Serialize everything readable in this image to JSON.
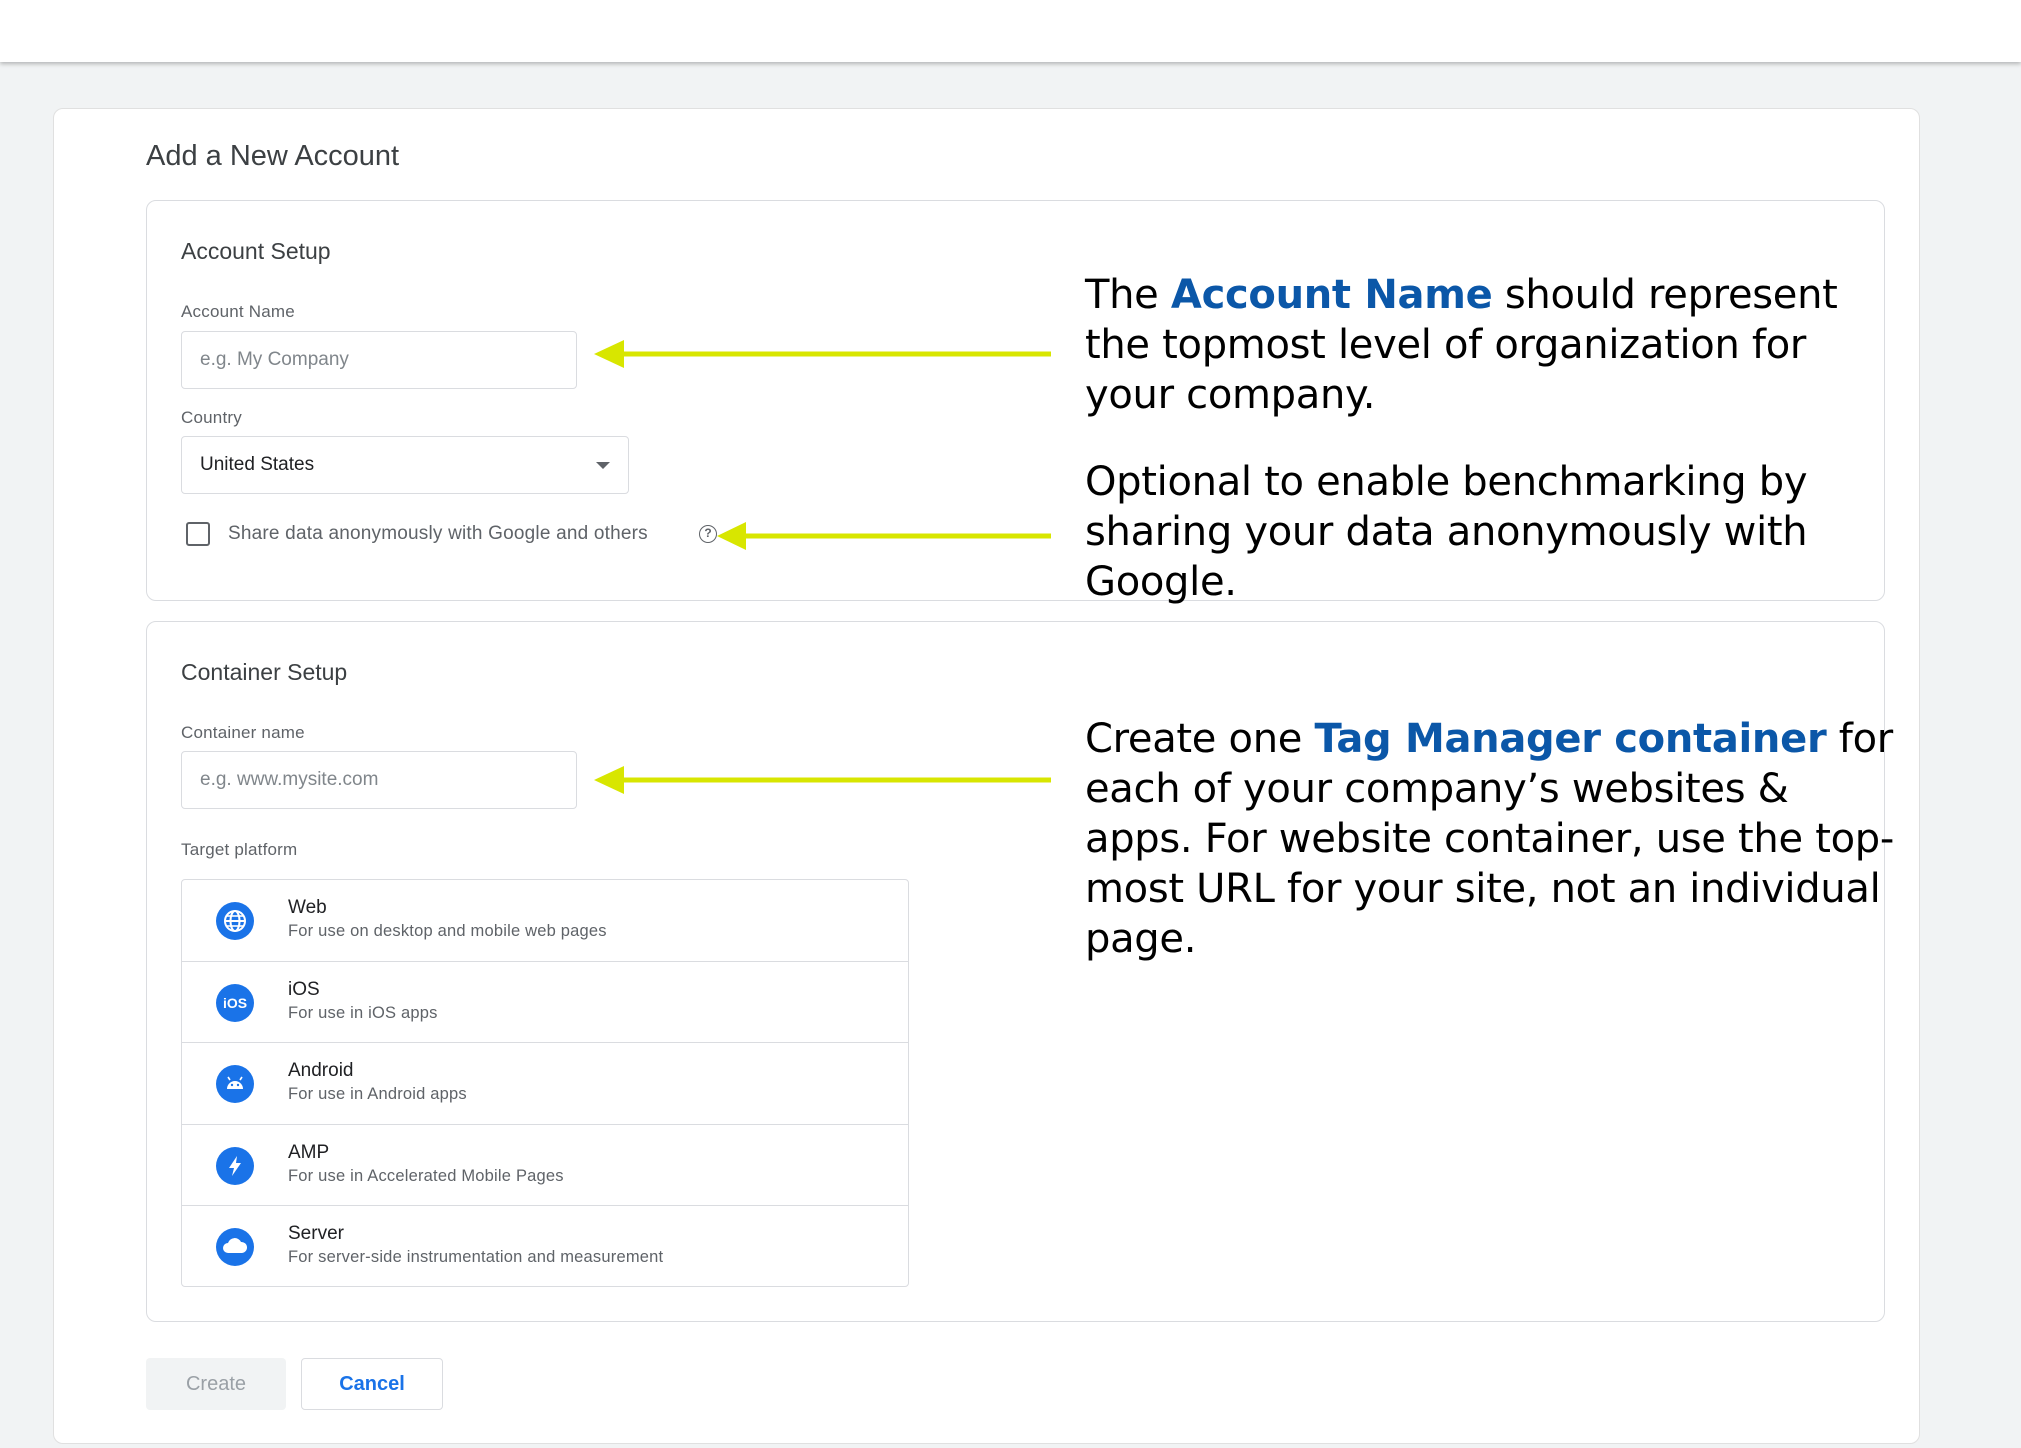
{
  "page": {
    "title": "Add a New Account"
  },
  "account_setup": {
    "title": "Account Setup",
    "account_name_label": "Account Name",
    "account_name_placeholder": "e.g. My Company",
    "country_label": "Country",
    "country_value": "United States",
    "share_data_label": "Share data anonymously with Google and others",
    "help_glyph": "?"
  },
  "container_setup": {
    "title": "Container Setup",
    "container_name_label": "Container name",
    "container_name_placeholder": "e.g. www.mysite.com",
    "target_platform_label": "Target platform",
    "platforms": [
      {
        "name": "Web",
        "description": "For use on desktop and mobile web pages",
        "icon": "globe-icon"
      },
      {
        "name": "iOS",
        "description": "For use in iOS apps",
        "icon": "ios-icon",
        "icon_text": "iOS"
      },
      {
        "name": "Android",
        "description": "For use in Android apps",
        "icon": "android-icon"
      },
      {
        "name": "AMP",
        "description": "For use in Accelerated Mobile Pages",
        "icon": "lightning-icon"
      },
      {
        "name": "Server",
        "description": "For server-side instrumentation and measurement",
        "icon": "cloud-icon"
      }
    ]
  },
  "actions": {
    "create_label": "Create",
    "cancel_label": "Cancel"
  },
  "annotations": {
    "account": {
      "pre": "The ",
      "highlight": "Account Name",
      "post": " should represent the topmost level of organization for your company."
    },
    "share": {
      "text": "Optional to enable benchmarking by sharing your data anonymously with Google."
    },
    "container": {
      "pre": "Create one ",
      "highlight": "Tag Manager container",
      "post": " for each of your company’s websites & apps. For website container, use the top-most URL for your site, not an individual page."
    }
  },
  "colors": {
    "accent": "#1a73e8",
    "highlight_text": "#0b57a8",
    "arrow": "#d8e600"
  }
}
